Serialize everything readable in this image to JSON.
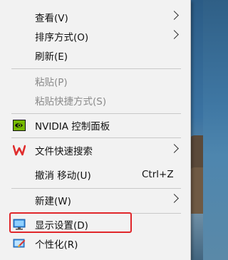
{
  "context_menu": {
    "items": [
      {
        "label": "查看(V)",
        "submenu": true
      },
      {
        "label": "排序方式(O)",
        "submenu": true
      },
      {
        "label": "刷新(E)"
      },
      {
        "label": "粘贴(P)",
        "disabled": true
      },
      {
        "label": "粘贴快捷方式(S)",
        "disabled": true
      },
      {
        "label": "NVIDIA 控制面板",
        "icon": "nvidia-icon"
      },
      {
        "label": "文件快速搜索",
        "icon": "wps-icon",
        "submenu": true
      },
      {
        "label": "撤消 移动(U)",
        "shortcut": "Ctrl+Z"
      },
      {
        "label": "新建(W)",
        "submenu": true
      },
      {
        "label": "显示设置(D)",
        "icon": "display-icon",
        "highlighted": true
      },
      {
        "label": "个性化(R)",
        "icon": "personalize-icon"
      }
    ]
  },
  "colors": {
    "menu_bg": "#f2f2f2",
    "highlight_border": "#e0262a",
    "disabled_text": "#8a8a8a"
  }
}
